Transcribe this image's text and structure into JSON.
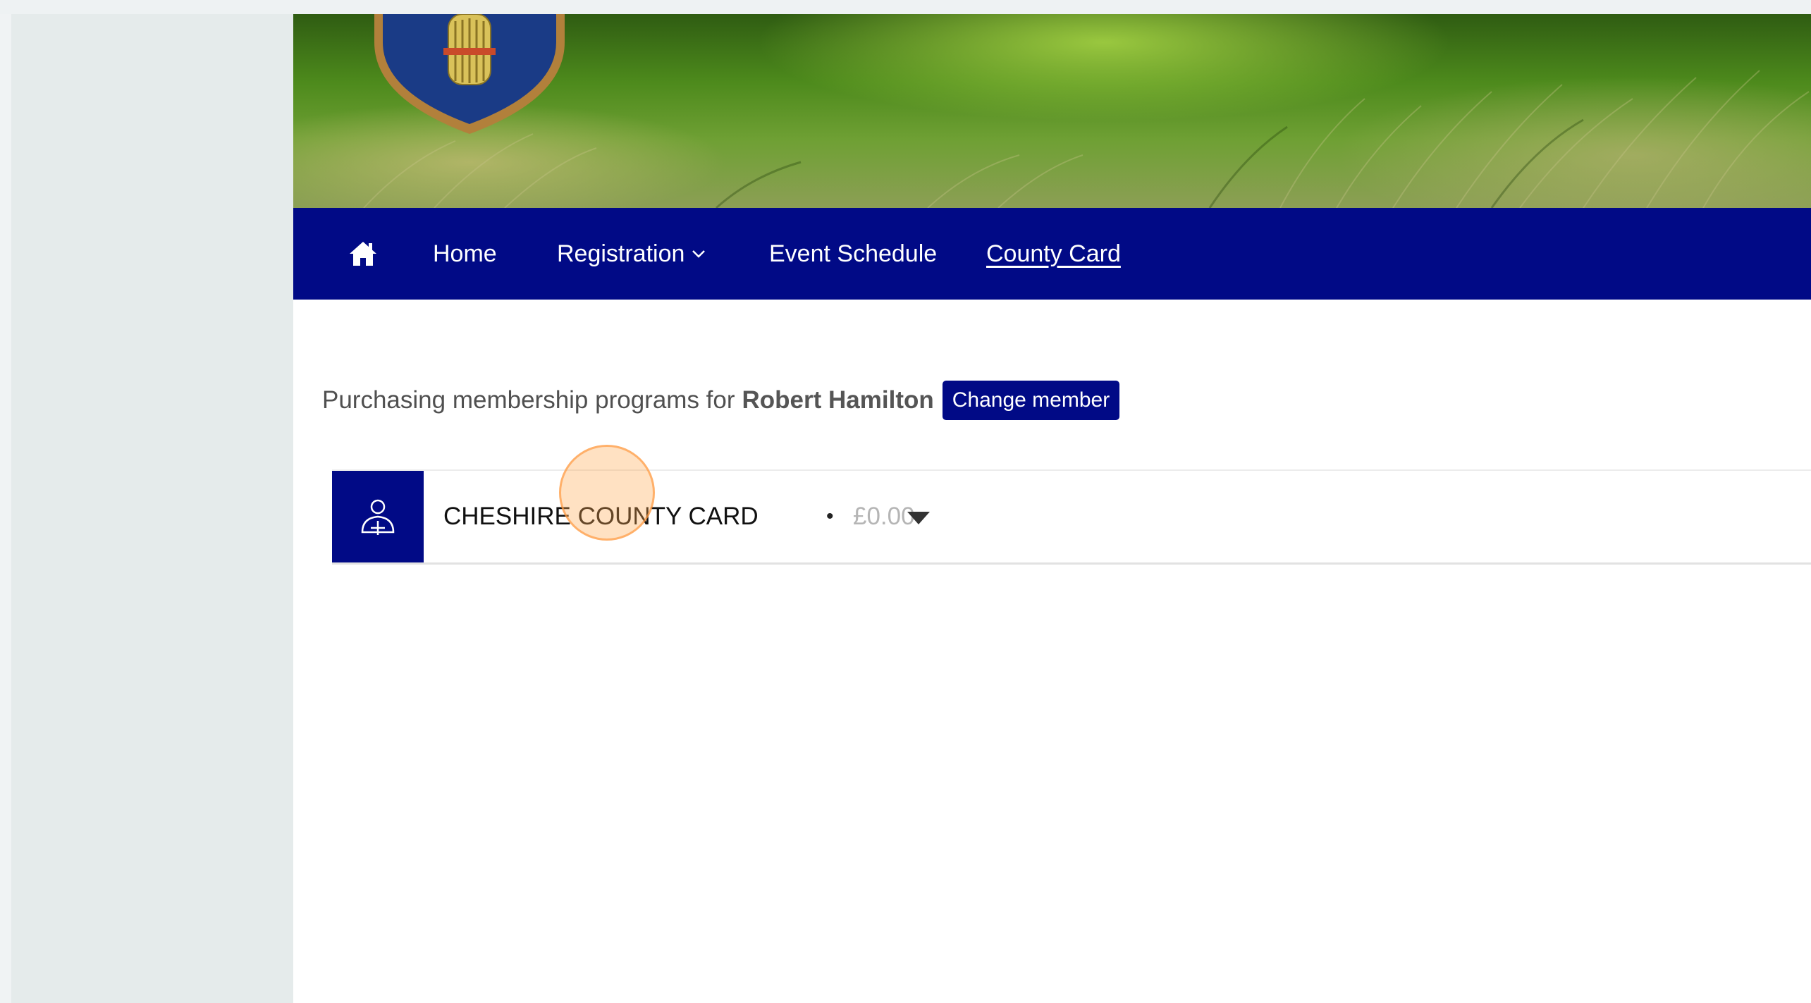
{
  "colors": {
    "nav_background": "#010a86",
    "accent": "#010a86",
    "price_text": "#b5b5b5"
  },
  "nav": {
    "home_icon": "home-icon",
    "items": [
      {
        "label": "Home"
      },
      {
        "label": "Registration"
      },
      {
        "label": "Event Schedule"
      },
      {
        "label": "County Card"
      }
    ],
    "dropdown_icon": "chevron-down-icon"
  },
  "purchasing": {
    "prefix": "Purchasing membership programs for",
    "member_name": "Robert Hamilton",
    "change_member_label": "Change member"
  },
  "card": {
    "icon": "user-add-icon",
    "title": "CHESHIRE COUNTY CARD",
    "separator": "•",
    "price": "£0.00",
    "toggle_icon": "caret-down-icon"
  }
}
